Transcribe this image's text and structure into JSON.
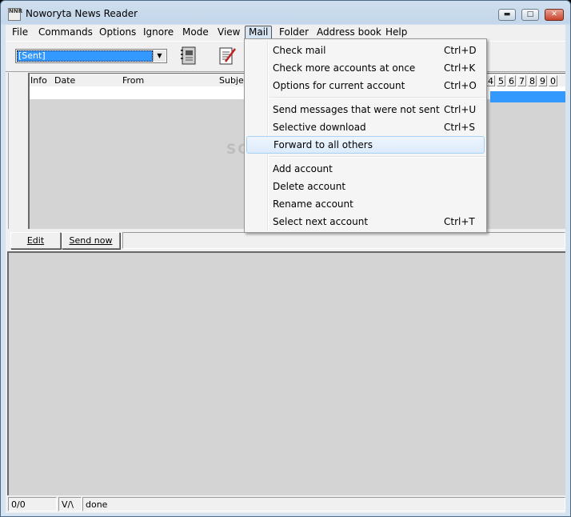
{
  "window": {
    "title": "Noworyta News Reader",
    "icon_text": "NNR"
  },
  "menubar": {
    "items": [
      "File",
      "Commands",
      "Options",
      "Ignore",
      "Mode",
      "View",
      "Mail",
      "Folder",
      "Address book",
      "Help"
    ]
  },
  "toolbar": {
    "folder_combo": "[Sent]"
  },
  "list": {
    "headers": [
      "Info",
      "Date",
      "From",
      "Subject"
    ],
    "letters": [
      "4",
      "5",
      "6",
      "7",
      "8",
      "9",
      "0"
    ]
  },
  "buttons": {
    "edit": "Edit",
    "send_now": "Send now"
  },
  "status": {
    "count": "0/0",
    "mode": "V/\\",
    "text": "done"
  },
  "mail_menu": {
    "groups": [
      [
        {
          "label": "Check mail",
          "shortcut": "Ctrl+D"
        },
        {
          "label": "Check more accounts at once",
          "shortcut": "Ctrl+K"
        },
        {
          "label": "Options for current account",
          "shortcut": "Ctrl+O"
        }
      ],
      [
        {
          "label": "Send messages that were not sent",
          "shortcut": "Ctrl+U"
        },
        {
          "label": "Selective download",
          "shortcut": "Ctrl+S"
        },
        {
          "label": "Forward to all others",
          "shortcut": ""
        }
      ],
      [
        {
          "label": "Add account",
          "shortcut": ""
        },
        {
          "label": "Delete account",
          "shortcut": ""
        },
        {
          "label": "Rename account",
          "shortcut": ""
        },
        {
          "label": "Select next account",
          "shortcut": "Ctrl+T"
        }
      ]
    ],
    "highlighted": "Forward to all others"
  },
  "watermark": "SOFTPEDIA"
}
